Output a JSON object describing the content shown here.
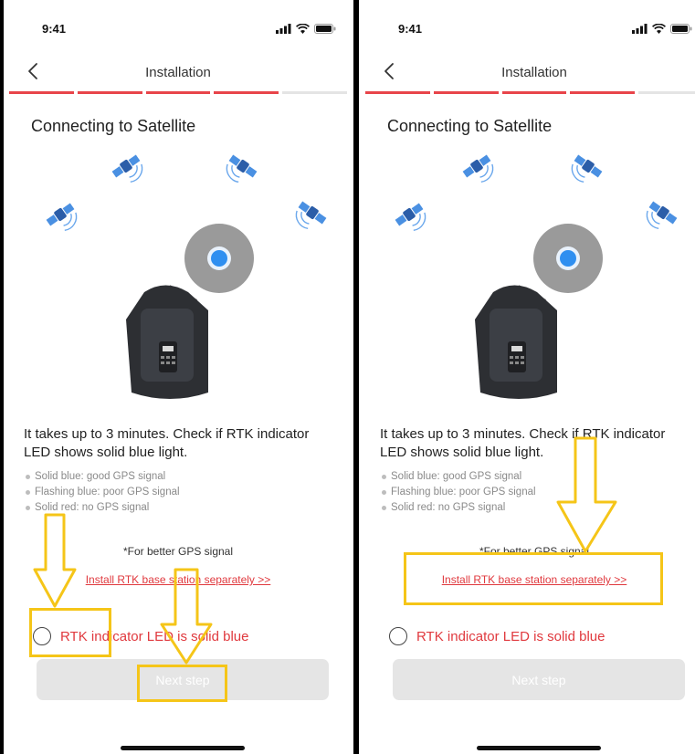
{
  "colors": {
    "accent_red": "#e8444a",
    "annotation_yellow": "#f5c518",
    "led_blue": "#2f8ff0",
    "button_disabled": "#e5e5e5"
  },
  "screens": [
    {
      "status_bar": {
        "time": "9:41",
        "icons": [
          "signal-icon",
          "wifi-icon",
          "battery-icon"
        ]
      },
      "nav": {
        "back_icon": "chevron-left-icon",
        "title": "Installation"
      },
      "progress": {
        "segments_total": 5,
        "segments_completed": 4
      },
      "heading": "Connecting  to Satellite",
      "description": "It takes up to 3 minutes. Check if RTK indicator LED shows solid blue light.",
      "bullets": [
        "Solid blue: good GPS signal",
        "Flashing blue: poor GPS signal",
        "Solid red: no GPS signal"
      ],
      "hint": "*For better GPS signal",
      "link": "Install RTK base station separately >>",
      "confirm_label": "RTK indicator LED is solid blue",
      "next_button": "Next step"
    },
    {
      "status_bar": {
        "time": "9:41",
        "icons": [
          "signal-icon",
          "wifi-icon",
          "battery-icon"
        ]
      },
      "nav": {
        "back_icon": "chevron-left-icon",
        "title": "Installation"
      },
      "progress": {
        "segments_total": 5,
        "segments_completed": 4
      },
      "heading": "Connecting  to Satellite",
      "description": "It takes up to 3 minutes. Check if RTK indicator LED shows solid blue light.",
      "bullets": [
        "Solid blue: good GPS signal",
        "Flashing blue: poor GPS signal",
        "Solid red: no GPS signal"
      ],
      "hint": "*For better GPS signal",
      "link": "Install RTK base station separately >>",
      "confirm_label": "RTK indicator LED is solid blue",
      "next_button": "Next step"
    }
  ]
}
